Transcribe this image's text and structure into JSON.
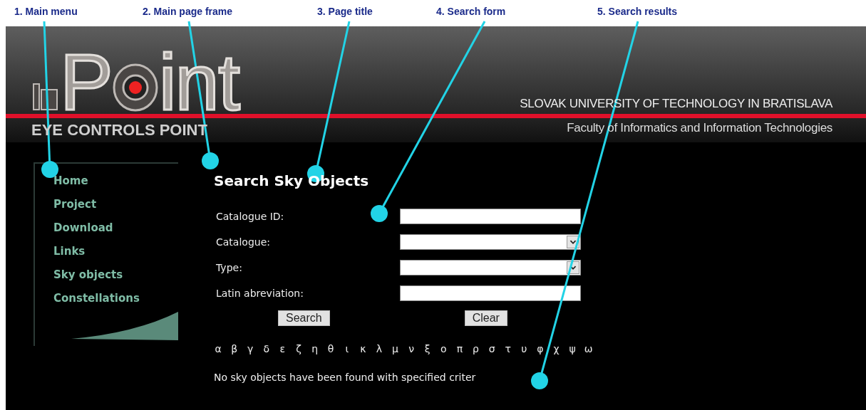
{
  "annotations": [
    {
      "label": "1. Main menu"
    },
    {
      "label": "2. Main page frame"
    },
    {
      "label": "3. Page title"
    },
    {
      "label": "4. Search form"
    },
    {
      "label": "5. Search results"
    }
  ],
  "header": {
    "logo_start": "P",
    "logo_end": "int",
    "tagline": "EYE CONTROLS POINT",
    "university": "SLOVAK UNIVERSITY OF TECHNOLOGY IN BRATISLAVA",
    "faculty": "Faculty of Informatics and Information Technologies"
  },
  "menu": {
    "items": [
      "Home",
      "Project",
      "Download",
      "Links",
      "Sky objects",
      "Constellations"
    ]
  },
  "page": {
    "title": "Search Sky Objects",
    "fields": [
      {
        "label": "Catalogue ID:",
        "kind": "text"
      },
      {
        "label": "Catalogue:",
        "kind": "select"
      },
      {
        "label": "Type:",
        "kind": "select"
      },
      {
        "label": "Latin abreviation:",
        "kind": "text"
      }
    ],
    "buttons": [
      "Search",
      "Clear"
    ],
    "letters": [
      "α",
      "β",
      "γ",
      "δ",
      "ε",
      "ζ",
      "η",
      "θ",
      "ι",
      "κ",
      "λ",
      "μ",
      "ν",
      "ξ",
      "ο",
      "π",
      "ρ",
      "σ",
      "τ",
      "υ",
      "φ",
      "χ",
      "ψ",
      "ω"
    ],
    "result": "No sky objects have been found with specified criter"
  }
}
